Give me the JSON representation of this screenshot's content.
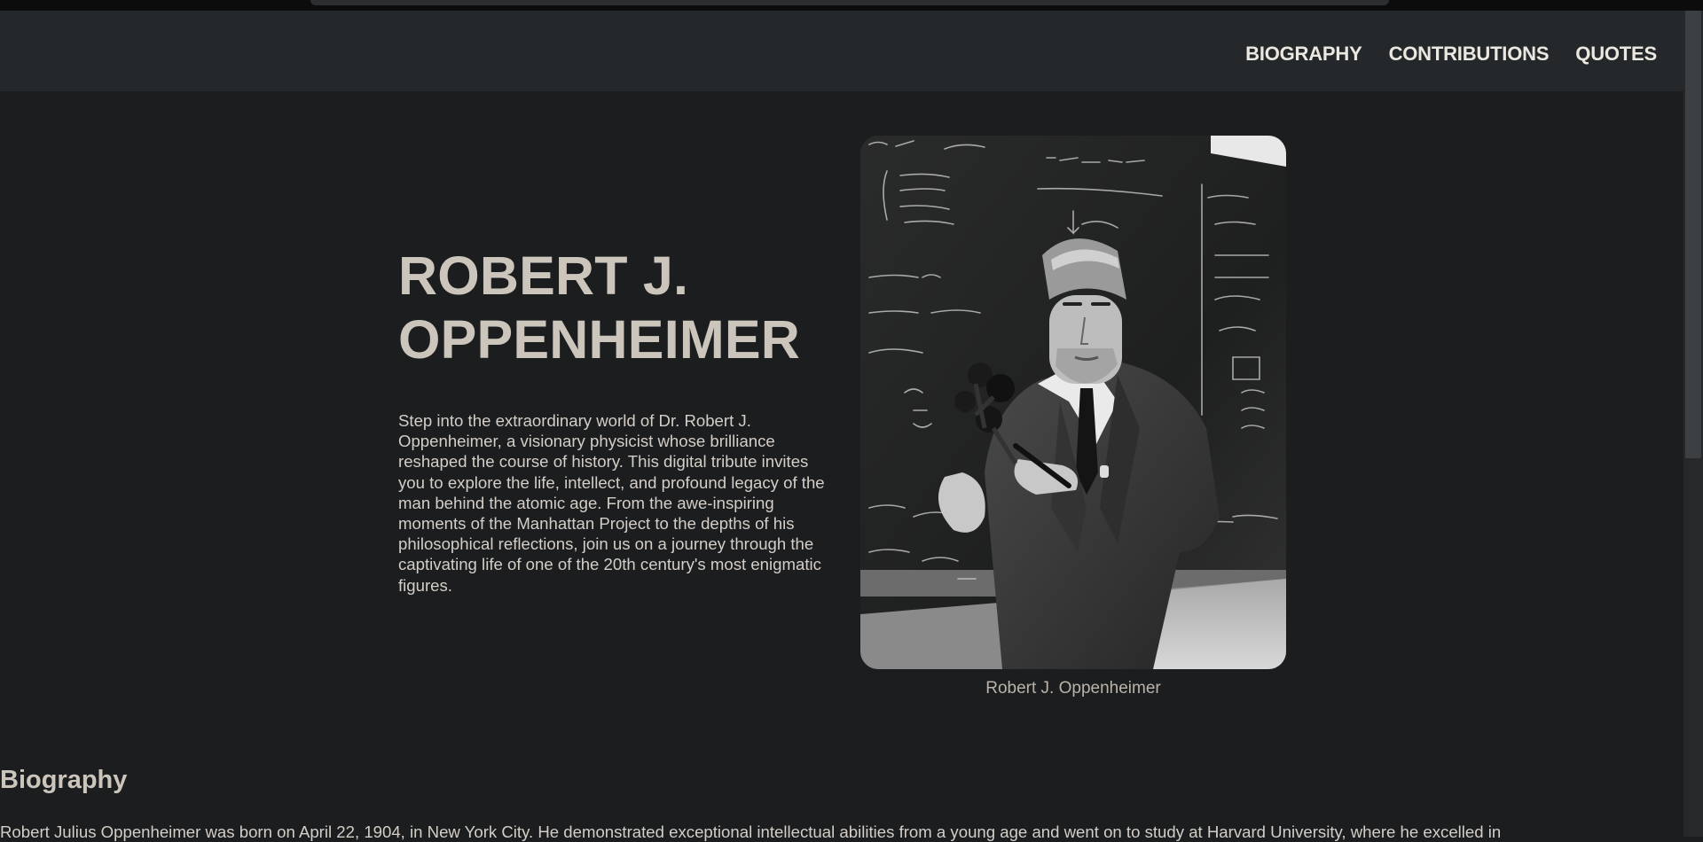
{
  "nav": {
    "links": [
      "BIOGRAPHY",
      "CONTRIBUTIONS",
      "QUOTES"
    ]
  },
  "hero": {
    "title_line1": "ROBERT J.",
    "title_line2": "OPPENHEIMER",
    "description": "Step into the extraordinary world of Dr. Robert J. Oppenheimer, a visionary physicist whose brilliance reshaped the course of history. This digital tribute invites you to explore the life, intellect, and profound legacy of the man behind the atomic age. From the awe-inspiring moments of the Manhattan Project to the depths of his philosophical reflections, join us on a journey through the captivating life of one of the 20th century's most enigmatic figures.",
    "image_caption": "Robert J. Oppenheimer"
  },
  "biography": {
    "heading": "Biography",
    "text": "Robert Julius Oppenheimer was born on April 22, 1904, in New York City. He demonstrated exceptional intellectual abilities from a young age and went on to study at Harvard University, where he excelled in"
  },
  "colors": {
    "background": "#1c1d1f",
    "navbar": "#25282a",
    "heading_text": "#cbc5bc",
    "body_text": "#d3cec7"
  }
}
